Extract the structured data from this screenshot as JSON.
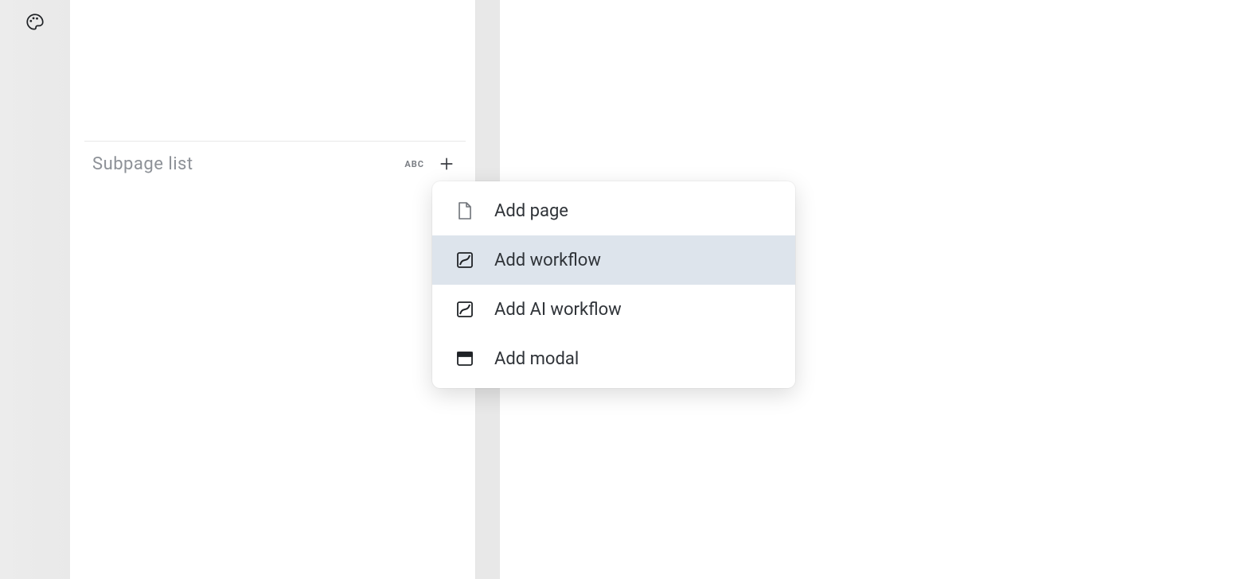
{
  "leftRail": {
    "paletteIcon": "palette-icon"
  },
  "panel": {
    "subpageHeader": {
      "title": "Subpage list",
      "abcLabel": "ABC"
    }
  },
  "dropdown": {
    "items": [
      {
        "label": "Add page",
        "icon": "page-icon",
        "hovered": false
      },
      {
        "label": "Add workflow",
        "icon": "workflow-icon",
        "hovered": true
      },
      {
        "label": "Add AI workflow",
        "icon": "workflow-icon",
        "hovered": false
      },
      {
        "label": "Add modal",
        "icon": "modal-icon",
        "hovered": false
      }
    ]
  }
}
